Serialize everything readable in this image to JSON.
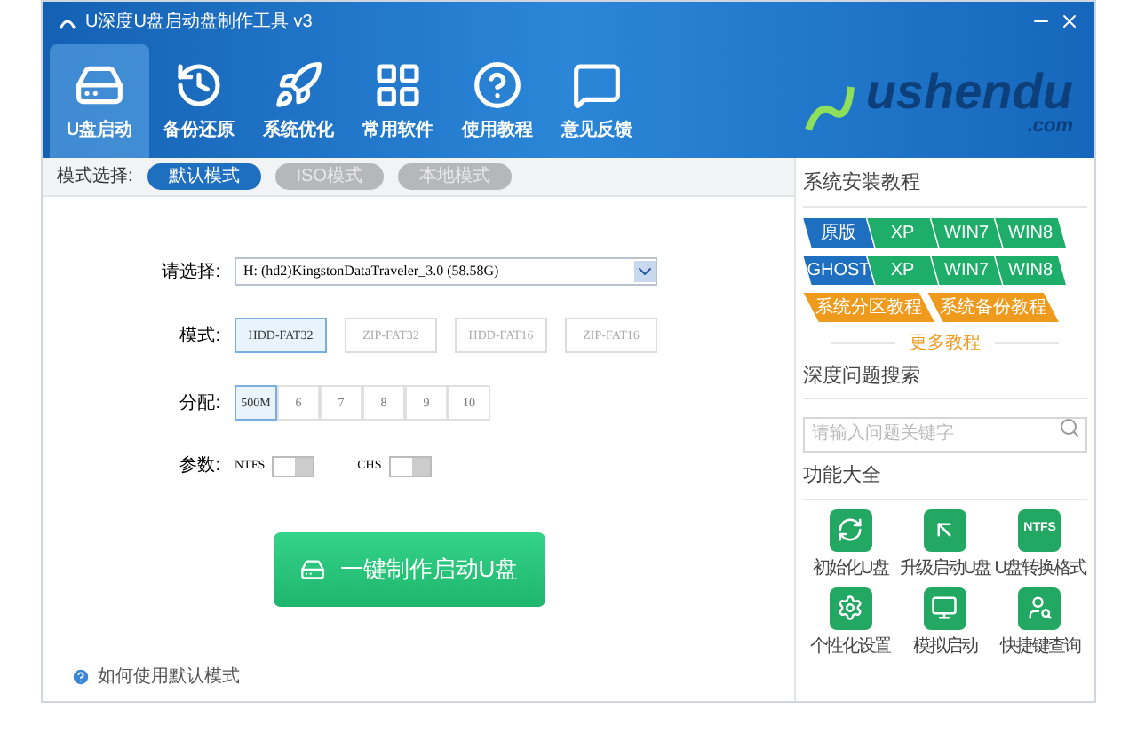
{
  "window": {
    "title": "U深度U盘启动盘制作工具 v3"
  },
  "tabs": [
    {
      "label": "U盘启动",
      "kind": "usb",
      "selected": true
    },
    {
      "label": "备份还原",
      "kind": "history",
      "selected": false
    },
    {
      "label": "系统优化",
      "kind": "rocket",
      "selected": false
    },
    {
      "label": "常用软件",
      "kind": "grid",
      "selected": false
    },
    {
      "label": "使用教程",
      "kind": "help",
      "selected": false
    },
    {
      "label": "意见反馈",
      "kind": "chat",
      "selected": false
    }
  ],
  "logo": {
    "name": "ushendu",
    "suffix": ".com"
  },
  "mode_bar": {
    "label": "模式选择:",
    "modes": [
      {
        "label": "默认模式",
        "selected": true
      },
      {
        "label": "ISO模式",
        "selected": false
      },
      {
        "label": "本地模式",
        "selected": false
      }
    ]
  },
  "form": {
    "drive_label": "请选择:",
    "drive_value": "H: (hd2)KingstonDataTraveler_3.0 (58.58G)",
    "mode_label": "模式:",
    "boot_modes": [
      {
        "label": "HDD-FAT32",
        "selected": true
      },
      {
        "label": "ZIP-FAT32",
        "selected": false
      },
      {
        "label": "HDD-FAT16",
        "selected": false
      },
      {
        "label": "ZIP-FAT16",
        "selected": false
      }
    ],
    "alloc_label": "分配:",
    "allocs": [
      {
        "label": "500M",
        "selected": true
      },
      {
        "label": "6",
        "selected": false
      },
      {
        "label": "7",
        "selected": false
      },
      {
        "label": "8",
        "selected": false
      },
      {
        "label": "9",
        "selected": false
      },
      {
        "label": "10",
        "selected": false
      }
    ],
    "params_label": "参数:",
    "params": [
      {
        "label": "NTFS",
        "on": false
      },
      {
        "label": "CHS",
        "on": false
      }
    ]
  },
  "make_button": "一键制作启动U盘",
  "help_link": "如何使用默认模式",
  "sidebar": {
    "install_title": "系统安装教程",
    "tag_rows": [
      [
        {
          "label": "原版",
          "color": "#1e6fbf"
        },
        {
          "label": "XP",
          "color": "#1fae6a"
        },
        {
          "label": "WIN7",
          "color": "#1fae6a"
        },
        {
          "label": "WIN8",
          "color": "#1fae6a"
        }
      ],
      [
        {
          "label": "GHOST",
          "color": "#1e6fbf"
        },
        {
          "label": "XP",
          "color": "#1fae6a"
        },
        {
          "label": "WIN7",
          "color": "#1fae6a"
        },
        {
          "label": "WIN8",
          "color": "#1fae6a"
        }
      ],
      [
        {
          "label": "系统分区教程",
          "color": "#ee9a1c"
        },
        {
          "label": "系统备份教程",
          "color": "#ee9a1c"
        }
      ]
    ],
    "more": "更多教程",
    "search_title": "深度问题搜索",
    "search_placeholder": "请输入问题关键字",
    "tools_title": "功能大全",
    "tools": [
      {
        "label": "初始化U盘",
        "kind": "refresh"
      },
      {
        "label": "升级启动U盘",
        "kind": "upgrade"
      },
      {
        "label": "U盘转换格式",
        "kind": "text",
        "icon_text": "NTFS"
      },
      {
        "label": "个性化设置",
        "kind": "settings"
      },
      {
        "label": "模拟启动",
        "kind": "monitor"
      },
      {
        "label": "快捷键查询",
        "kind": "search"
      }
    ]
  }
}
